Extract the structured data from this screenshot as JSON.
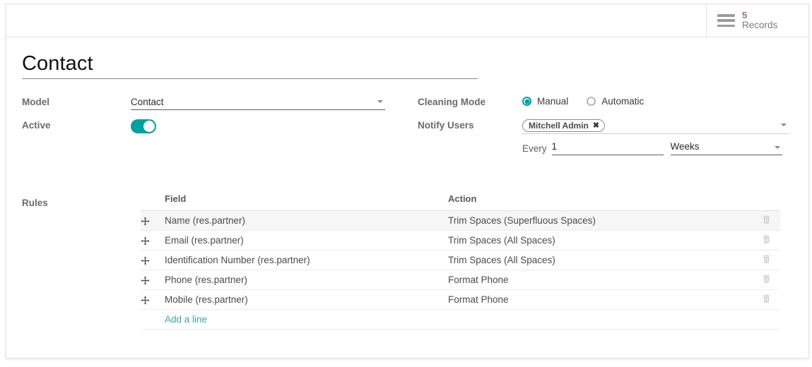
{
  "topbar": {
    "stat_button": {
      "icon": "list-lines-icon",
      "value": "5",
      "label": "Records"
    }
  },
  "form": {
    "title": "Contact",
    "left_fields": {
      "model_label": "Model",
      "model_value": "Contact",
      "active_label": "Active",
      "active_on": true
    },
    "right_fields": {
      "cleaning_mode_label": "Cleaning Mode",
      "cleaning_mode_options": [
        "Manual",
        "Automatic"
      ],
      "cleaning_mode_selected": "Manual",
      "notify_users_label": "Notify Users",
      "notify_users_tags": [
        "Mitchell Admin"
      ],
      "every_label": "Every",
      "every_value": "1",
      "interval_value": "Weeks"
    },
    "rules": {
      "label": "Rules",
      "columns": [
        "Field",
        "Action"
      ],
      "rows": [
        {
          "field": "Name (res.partner)",
          "action": "Trim Spaces (Superfluous Spaces)"
        },
        {
          "field": "Email (res.partner)",
          "action": "Trim Spaces (All Spaces)"
        },
        {
          "field": "Identification Number (res.partner)",
          "action": "Trim Spaces (All Spaces)"
        },
        {
          "field": "Phone (res.partner)",
          "action": "Format Phone"
        },
        {
          "field": "Mobile (res.partner)",
          "action": "Format Phone"
        }
      ],
      "add_line_label": "Add a line"
    }
  },
  "colors": {
    "accent_teal": "#00a09d",
    "link_teal": "#3aa7a4",
    "stat_value": "#8f7393",
    "label_gray": "#6b6b6b"
  }
}
